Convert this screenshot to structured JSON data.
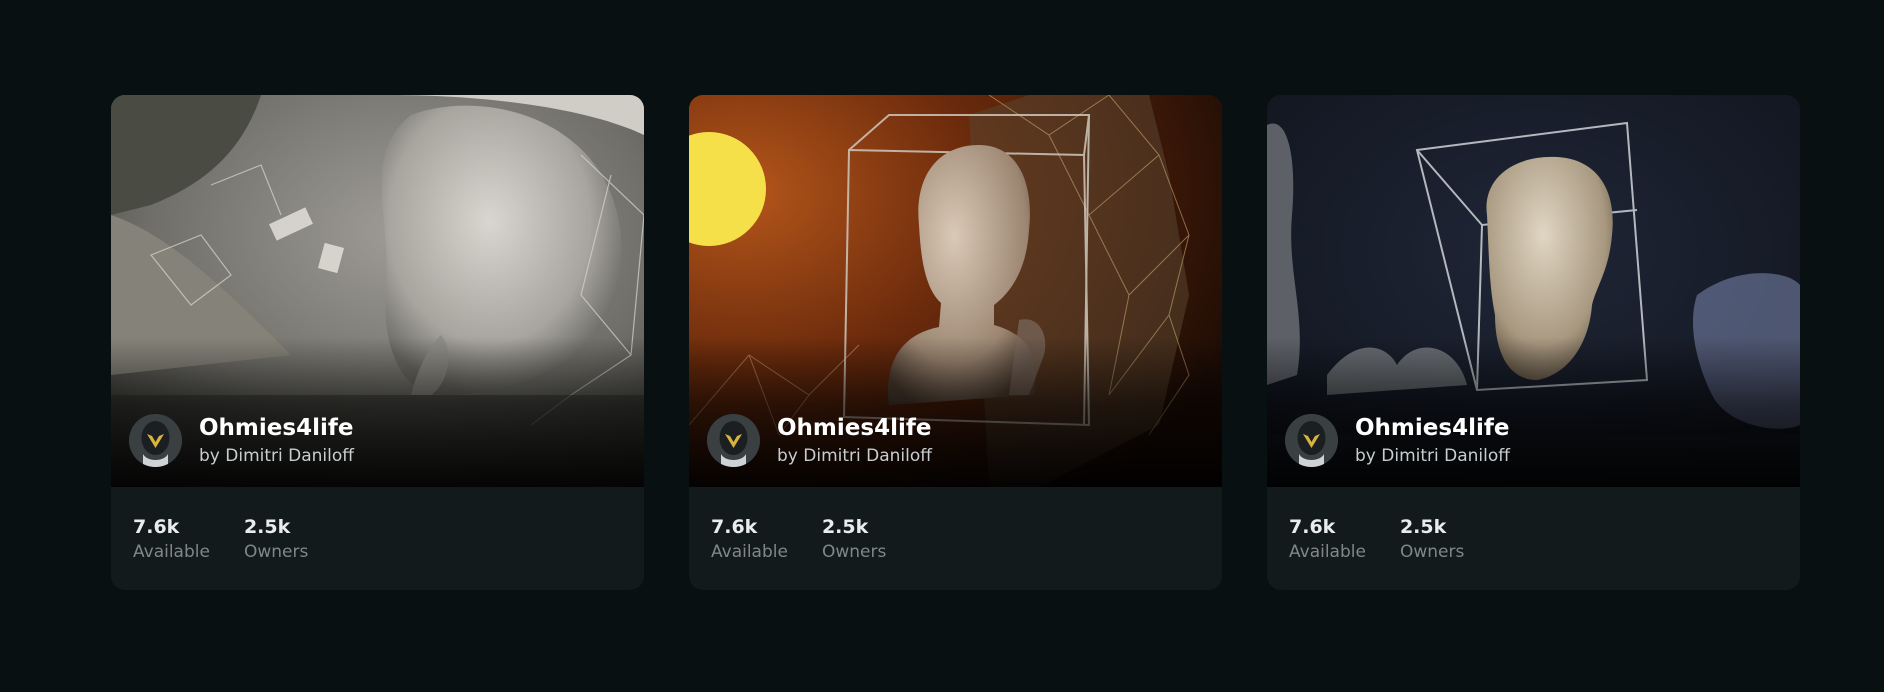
{
  "cards": [
    {
      "image_alt": "White abstract sculpture with lattice structure",
      "title": "Ohmies4life",
      "byline": "by Dimitri Daniloff",
      "stats": [
        {
          "value": "7.6k",
          "label": "Available"
        },
        {
          "value": "2.5k",
          "label": "Owners"
        }
      ]
    },
    {
      "image_alt": "Roman bust in wireframe cube with orange sunset",
      "title": "Ohmies4life",
      "byline": "by Dimitri Daniloff",
      "stats": [
        {
          "value": "7.6k",
          "label": "Available"
        },
        {
          "value": "2.5k",
          "label": "Owners"
        }
      ]
    },
    {
      "image_alt": "Bearded philosopher head in wireframe cube on dark blue",
      "title": "Ohmies4life",
      "byline": "by Dimitri Daniloff",
      "stats": [
        {
          "value": "7.6k",
          "label": "Available"
        },
        {
          "value": "2.5k",
          "label": "Owners"
        }
      ]
    }
  ],
  "colors": {
    "background": "#081012",
    "card": "#131a1c",
    "sun": "#f5e04a",
    "orange": "#8a3a10",
    "navy": "#171d2a"
  }
}
